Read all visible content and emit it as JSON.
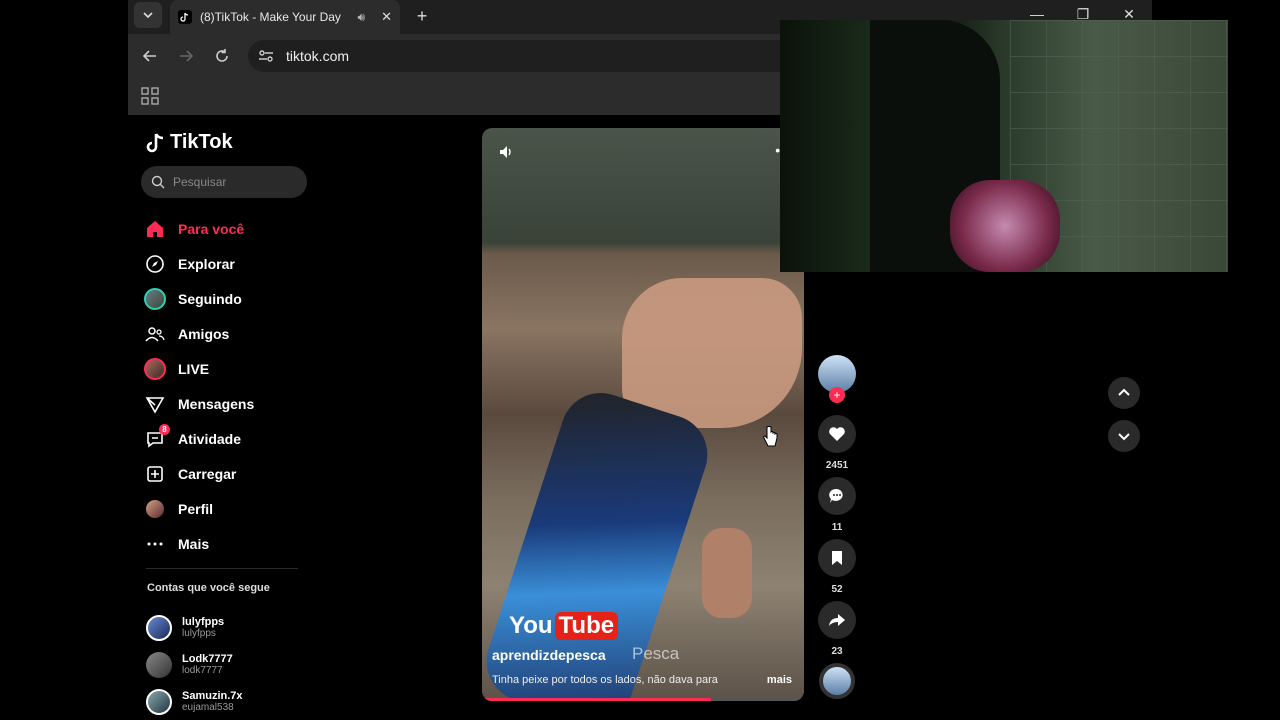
{
  "browser": {
    "tab_title": "(8)TikTok - Make Your Day",
    "url": "tiktok.com"
  },
  "sidebar": {
    "logo_text": "TikTok",
    "search_placeholder": "Pesquisar",
    "nav": [
      {
        "label": "Para você",
        "icon": "home-icon",
        "active": true
      },
      {
        "label": "Explorar",
        "icon": "compass-icon"
      },
      {
        "label": "Seguindo",
        "icon": "avatar"
      },
      {
        "label": "Amigos",
        "icon": "friends-icon"
      },
      {
        "label": "LIVE",
        "icon": "avatar"
      },
      {
        "label": "Mensagens",
        "icon": "send-icon"
      },
      {
        "label": "Atividade",
        "icon": "inbox-icon",
        "badge": "8"
      },
      {
        "label": "Carregar",
        "icon": "upload-icon"
      },
      {
        "label": "Perfil",
        "icon": "avatar"
      },
      {
        "label": "Mais",
        "icon": "more-icon"
      }
    ],
    "following_title": "Contas que você segue",
    "following": [
      {
        "name": "lulyfpps",
        "handle": "lulyfpps"
      },
      {
        "name": "Lodk7777",
        "handle": "lodk7777"
      },
      {
        "name": "Samuzin.7x",
        "handle": "eujamal538"
      }
    ]
  },
  "video": {
    "author": "aprendizdepesca",
    "overlay_text": "Pesca",
    "watermark_you": "You",
    "watermark_tube": "Tube",
    "caption": "Tinha peixe por todos os lados, não dava para",
    "more_label": "mais",
    "progress": 0.71
  },
  "actions": {
    "likes": "2451",
    "comments": "11",
    "saves": "52",
    "shares": "23"
  },
  "colors": {
    "accent": "#fe2c55",
    "background": "#000000"
  }
}
